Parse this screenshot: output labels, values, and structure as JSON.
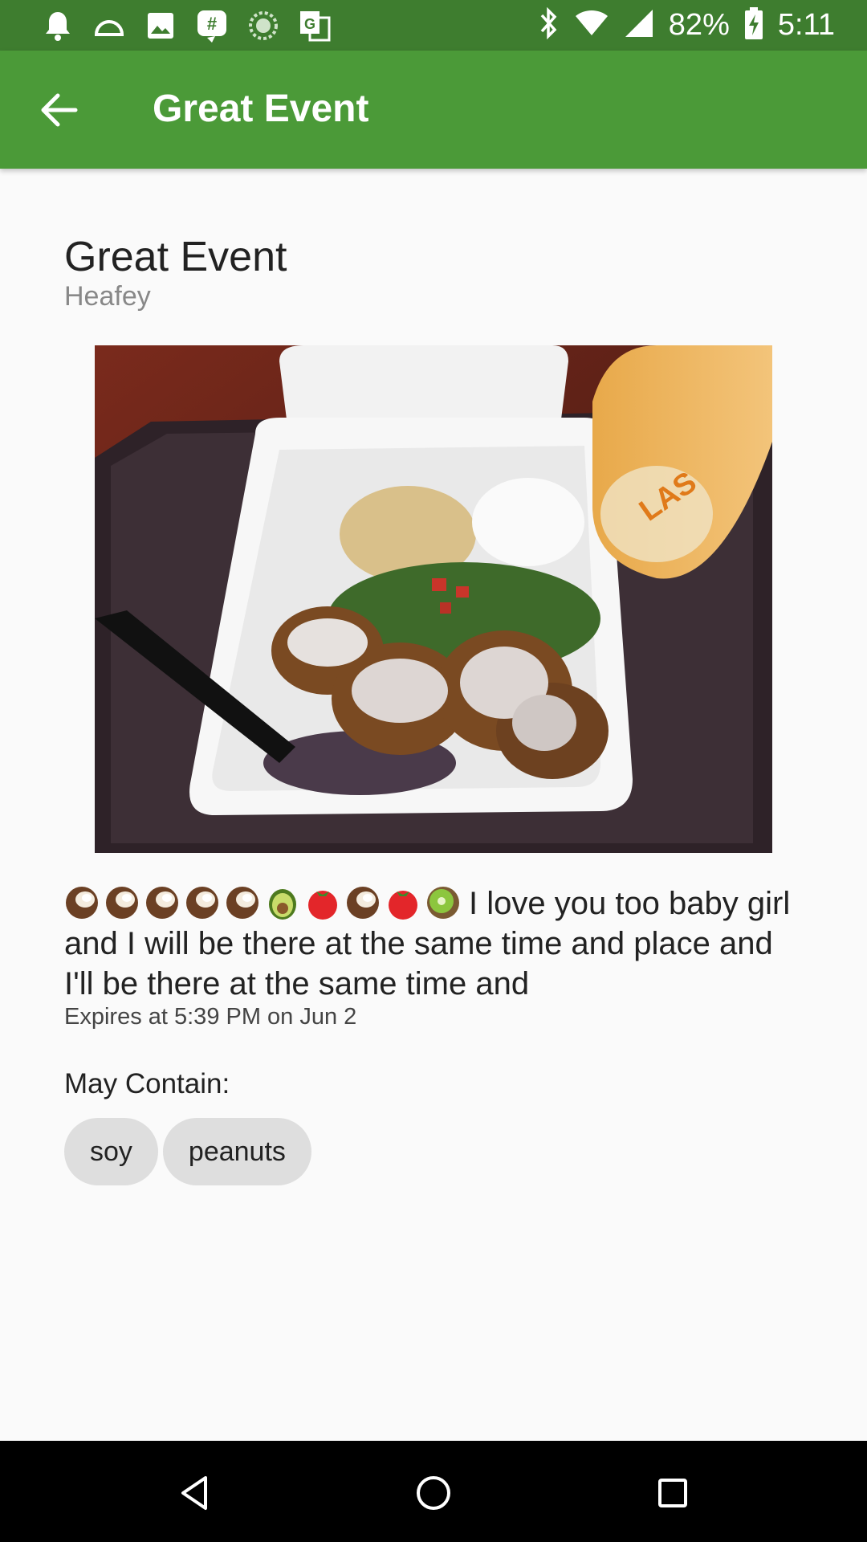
{
  "status_bar": {
    "left_icons": [
      "bell-icon",
      "cloud-icon",
      "image-icon",
      "hashtag-app-icon",
      "sync-icon",
      "translate-icon"
    ],
    "battery": "82%",
    "time": "5:11"
  },
  "app_bar": {
    "title": "Great Event"
  },
  "event": {
    "title": "Great Event",
    "host": "Heafey",
    "emojis": [
      "coconut",
      "coconut",
      "coconut",
      "coconut",
      "coconut",
      "avocado",
      "tomato",
      "coconut",
      "tomato",
      "kiwi"
    ],
    "description": "I love you too baby girl and I will be there at the same time and place and I'll be there at the same time and",
    "expires": "Expires at 5:39 PM on Jun 2",
    "may_contain_label": "May Contain:",
    "allergens": [
      "soy",
      "peanuts"
    ]
  },
  "colors": {
    "status_bar": "#3e7d2f",
    "app_bar": "#4b9a38",
    "chip": "#dedede"
  }
}
